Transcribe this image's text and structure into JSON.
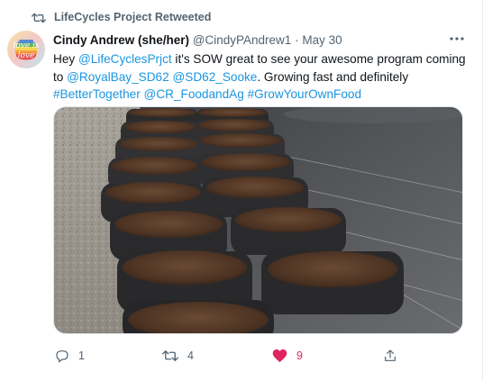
{
  "retweet": {
    "label": "LifeCycles Project Retweeted"
  },
  "author": {
    "name": "Cindy Andrew (she/her)",
    "handle": "@CindyPAndrew1",
    "separator": "·",
    "date": "May 30",
    "avatar_text": "love is love"
  },
  "tweet": {
    "t1": "Hey ",
    "m1": "@LifeCyclesPrjct",
    "t2": " it's SOW great to see your awesome program coming to ",
    "m2": "@RoyalBay_SD62",
    "t3": " ",
    "m3": "@SD62_Sooke",
    "t4": ". Growing fast and definitely ",
    "h1": "#BetterTogether",
    "t5": " ",
    "m4": "@CR_FoodandAg",
    "t6": " ",
    "h2": "#GrowYourOwnFood"
  },
  "actions": {
    "reply_count": "1",
    "retweet_count": "4",
    "like_count": "9"
  },
  "colors": {
    "link": "#1b95e0",
    "like": "#e0245e",
    "muted": "#536471"
  },
  "icons": [
    "retweet-icon",
    "more-icon",
    "reply-icon",
    "like-icon",
    "share-icon"
  ]
}
